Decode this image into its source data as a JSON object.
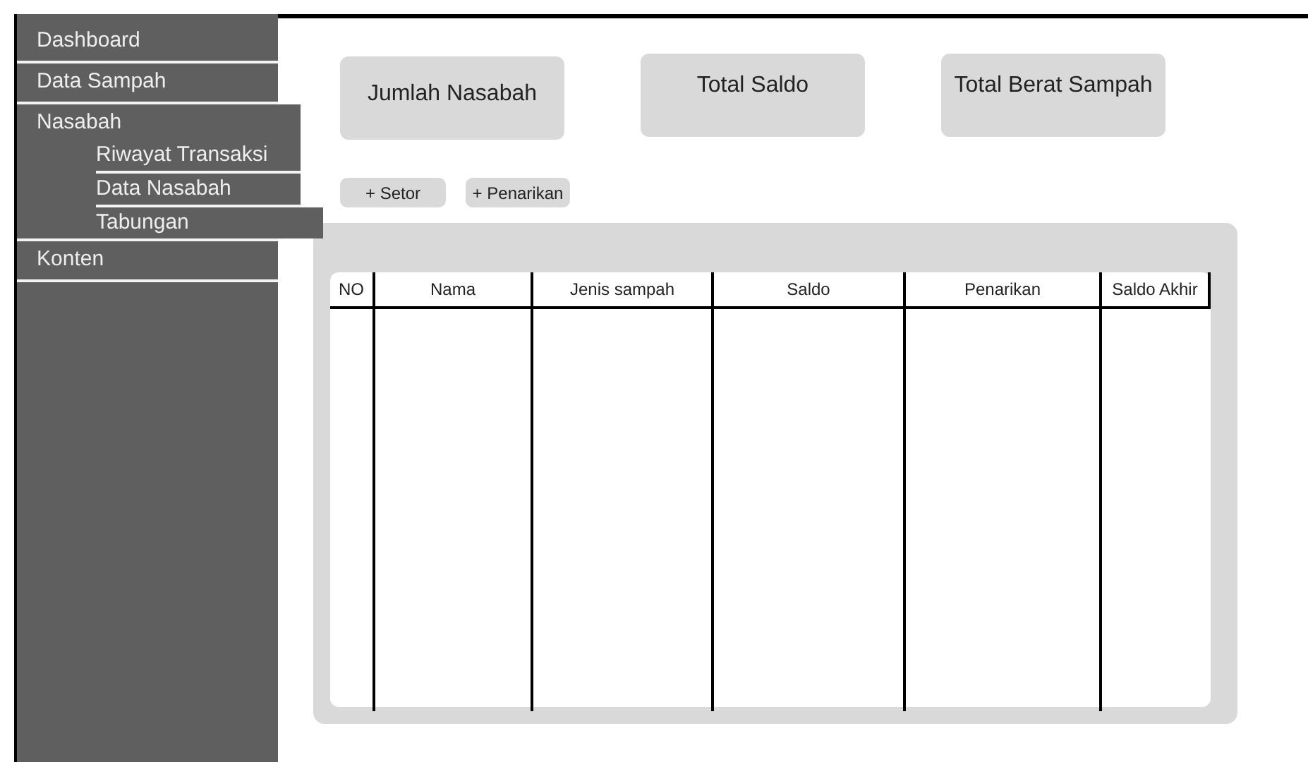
{
  "sidebar": {
    "items": [
      {
        "label": "Dashboard"
      },
      {
        "label": "Data Sampah"
      },
      {
        "label": "Nasabah",
        "children": [
          {
            "label": "Riwayat Transaksi"
          },
          {
            "label": "Data Nasabah"
          },
          {
            "label": "Tabungan"
          }
        ]
      },
      {
        "label": "Konten"
      }
    ]
  },
  "summary_cards": [
    {
      "label": "Jumlah Nasabah"
    },
    {
      "label": "Total Saldo"
    },
    {
      "label": "Total Berat Sampah"
    }
  ],
  "actions": [
    "+ Setor",
    "+ Penarikan"
  ],
  "table": {
    "columns": [
      "NO",
      "Nama",
      "Jenis sampah",
      "Saldo",
      "Penarikan",
      "Saldo Akhir"
    ]
  }
}
